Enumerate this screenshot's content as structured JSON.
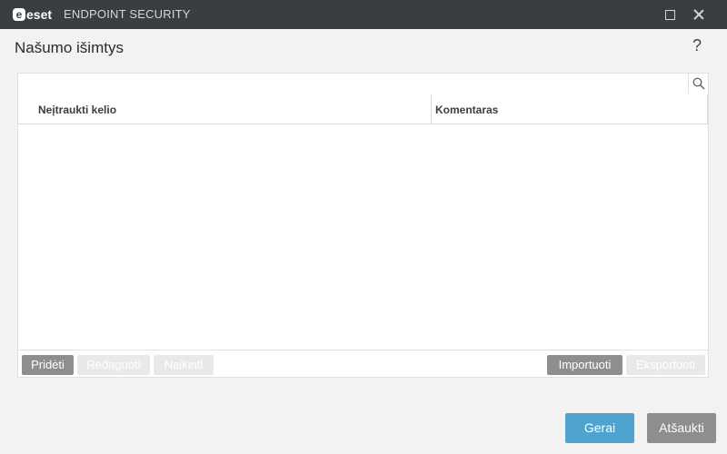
{
  "window": {
    "brand": "eset",
    "product": "ENDPOINT SECURITY"
  },
  "page": {
    "title": "Našumo išimtys",
    "help": "?"
  },
  "search": {
    "value": "",
    "placeholder": ""
  },
  "table": {
    "columns": [
      "Neįtraukti kelio",
      "Komentaras"
    ],
    "rows": []
  },
  "toolbar": {
    "add": "Pridėti",
    "edit": "Redaguoti",
    "delete": "Naikinti",
    "import": "Importuoti",
    "export": "Eksportuoti"
  },
  "dialog": {
    "ok": "Gerai",
    "cancel": "Atšaukti"
  },
  "colors": {
    "titlebar": "#3a3d41",
    "primary": "#4fa3d1",
    "neutral_button": "#8c8e90",
    "disabled_button": "#e9e9e9"
  }
}
